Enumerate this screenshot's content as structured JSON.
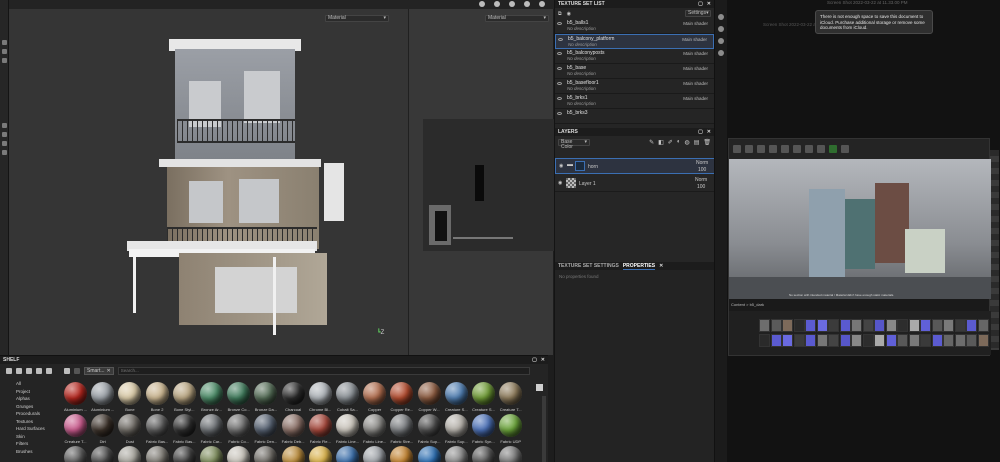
{
  "viewport": {
    "left_material": "Material",
    "right_material": "Material",
    "axis_label": "Z"
  },
  "texture_set_list": {
    "title": "TEXTURE SET LIST",
    "settings_label": "Settings",
    "items": [
      {
        "name": "b5_balls1",
        "desc": "No description",
        "shader": "Main shader"
      },
      {
        "name": "b5_balcony_platform",
        "desc": "No description",
        "shader": "Main shader"
      },
      {
        "name": "b5_balconyposts",
        "desc": "No description",
        "shader": "Main shader"
      },
      {
        "name": "b5_base",
        "desc": "No description",
        "shader": "Main shader"
      },
      {
        "name": "b5_basefloor1",
        "desc": "No description",
        "shader": "Main shader"
      },
      {
        "name": "b5_brks1",
        "desc": "No description",
        "shader": "Main shader"
      },
      {
        "name": "b5_brks3",
        "desc": "",
        "shader": ""
      }
    ]
  },
  "layers": {
    "title": "LAYERS",
    "channel": "Base Color",
    "rows": [
      {
        "name": "horn",
        "blend": "Norm",
        "opacity": "100"
      },
      {
        "name": "Layer 1",
        "blend": "Norm",
        "opacity": "100"
      }
    ]
  },
  "properties": {
    "tab_tss": "TEXTURE SET SETTINGS",
    "tab_props": "PROPERTIES",
    "empty": "No properties found"
  },
  "notification": {
    "text": "There is not enough space to save this document to iCloud. Purchase additional storage or remove some documents from iCloud."
  },
  "desktop": {
    "line1": "Screen Shot 2022-03-22 at 11.33.00 PM",
    "line2": "Screen Shot 2022-03-22 at 11.33.55 PM"
  },
  "unreal": {
    "caption": "No section with intended material / Material didn't have enough static materials.",
    "breadcrumb": "Content > b5_dark"
  },
  "shelf": {
    "title": "SHELF",
    "filter_chip": "Smart...",
    "search_placeholder": "Search...",
    "categories": [
      "All",
      "Project",
      "Alphas",
      "Grunges",
      "Procedurals",
      "Textures",
      "Hard Surfaces",
      "Skin",
      "Filters",
      "Brushes"
    ],
    "row1": [
      {
        "label": "Aluminium ...",
        "color": "#b3261e"
      },
      {
        "label": "Aluminium ...",
        "color": "#9aa0a6"
      },
      {
        "label": "Bone",
        "color": "#d8c9a6"
      },
      {
        "label": "Bone 2",
        "color": "#c9b48f"
      },
      {
        "label": "Bone Styl...",
        "color": "#b9a682"
      },
      {
        "label": "Bronze Ar...",
        "color": "#4a8a66"
      },
      {
        "label": "Bronze Co...",
        "color": "#3f7a5b"
      },
      {
        "label": "Bronze Da...",
        "color": "#536b55"
      },
      {
        "label": "Charcoal",
        "color": "#2b2b2b"
      },
      {
        "label": "Chrome Bl...",
        "color": "#aeb3b8"
      },
      {
        "label": "Cobalt Sa...",
        "color": "#8a9095"
      },
      {
        "label": "Copper",
        "color": "#b06d4e"
      },
      {
        "label": "Copper Re...",
        "color": "#b14a2d"
      },
      {
        "label": "Copper W...",
        "color": "#8b5a3f"
      },
      {
        "label": "Creature S...",
        "color": "#4f7db0"
      },
      {
        "label": "Creature S...",
        "color": "#6e9a35"
      },
      {
        "label": "Creature T...",
        "color": "#8c7a5a"
      }
    ],
    "row2": [
      {
        "label": "Creature T...",
        "color": "#c85a8c"
      },
      {
        "label": "Dirt",
        "color": "#3a3028"
      },
      {
        "label": "Dust",
        "color": "#6e6a64"
      },
      {
        "label": "Fabric Bas...",
        "color": "#5a5a5a"
      },
      {
        "label": "Fabric Bas...",
        "color": "#2c2c2c"
      },
      {
        "label": "Fabric Car...",
        "color": "#6b6f73"
      },
      {
        "label": "Fabric Co...",
        "color": "#707070"
      },
      {
        "label": "Fabric Den...",
        "color": "#556070"
      },
      {
        "label": "Fabric Deb...",
        "color": "#8a6f66"
      },
      {
        "label": "Fabric Fle...",
        "color": "#a4463a"
      },
      {
        "label": "Fabric Line...",
        "color": "#c9c4bb"
      },
      {
        "label": "Fabric Line...",
        "color": "#8b8a87"
      },
      {
        "label": "Fabric Stre...",
        "color": "#7a7d80"
      },
      {
        "label": "Fabric Sup...",
        "color": "#4d4d4d"
      },
      {
        "label": "Fabric Sup...",
        "color": "#b5b1aa"
      },
      {
        "label": "Fabric Syn...",
        "color": "#4a6fb5"
      },
      {
        "label": "Fabric UDP",
        "color": "#6aa33a"
      }
    ],
    "row3": [
      {
        "label": "",
        "color": "#5a5a5a"
      },
      {
        "label": "",
        "color": "#4a4a4a"
      },
      {
        "label": "",
        "color": "#a7a59d"
      },
      {
        "label": "",
        "color": "#7d7a73"
      },
      {
        "label": "",
        "color": "#3d3d3d"
      },
      {
        "label": "",
        "color": "#7b8a5a"
      },
      {
        "label": "",
        "color": "#c6c2b9"
      },
      {
        "label": "",
        "color": "#6f6c66"
      },
      {
        "label": "",
        "color": "#b88a3a"
      },
      {
        "label": "",
        "color": "#d7b04a"
      },
      {
        "label": "",
        "color": "#3a6da8"
      },
      {
        "label": "",
        "color": "#9fa3a8"
      },
      {
        "label": "",
        "color": "#c0812f"
      },
      {
        "label": "",
        "color": "#2b6db0"
      },
      {
        "label": "",
        "color": "#8a8a8a"
      },
      {
        "label": "",
        "color": "#555555"
      },
      {
        "label": "",
        "color": "#777777"
      }
    ]
  }
}
